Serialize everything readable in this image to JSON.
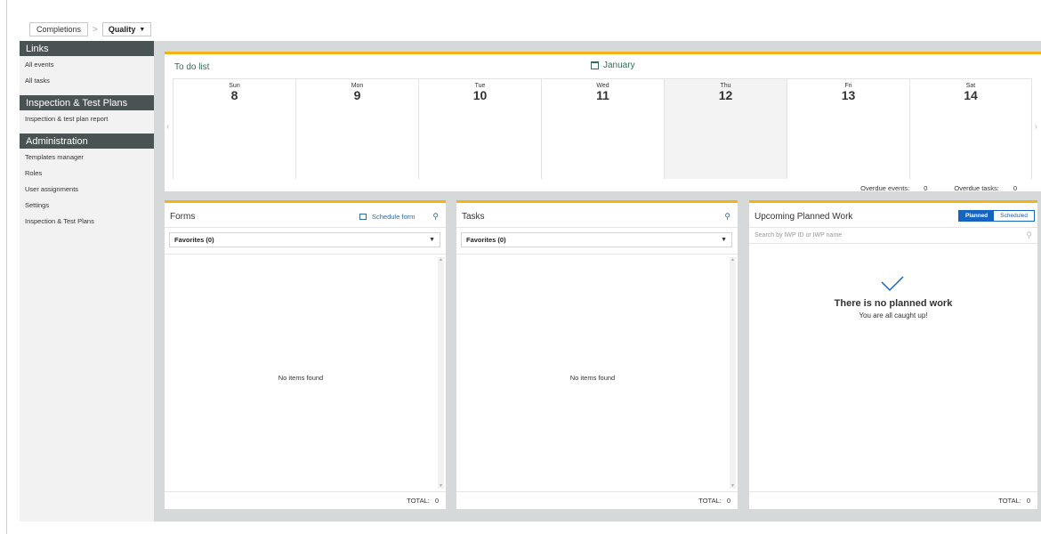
{
  "breadcrumb": {
    "root": "Completions",
    "separator": ">",
    "current": "Quality"
  },
  "sidebar": {
    "sections": [
      {
        "title": "Links",
        "items": [
          "All events",
          "All tasks"
        ]
      },
      {
        "title": "Inspection & Test Plans",
        "items": [
          "Inspection & test plan report"
        ]
      },
      {
        "title": "Administration",
        "items": [
          "Templates manager",
          "Roles",
          "User assignments",
          "Settings",
          "Inspection & Test Plans"
        ]
      }
    ]
  },
  "todo": {
    "title": "To do list",
    "month": "January",
    "days": [
      {
        "name": "Sun",
        "num": "8"
      },
      {
        "name": "Mon",
        "num": "9"
      },
      {
        "name": "Tue",
        "num": "10"
      },
      {
        "name": "Wed",
        "num": "11"
      },
      {
        "name": "Thu",
        "num": "12"
      },
      {
        "name": "Fri",
        "num": "13"
      },
      {
        "name": "Sat",
        "num": "14"
      }
    ],
    "overdue_events_label": "Overdue events:",
    "overdue_events_value": "0",
    "overdue_tasks_label": "Overdue tasks:",
    "overdue_tasks_value": "0"
  },
  "forms": {
    "title": "Forms",
    "schedule_label": "Schedule form",
    "dropdown": "Favorites (0)",
    "empty": "No items found",
    "total_label": "TOTAL:",
    "total_value": "0"
  },
  "tasks": {
    "title": "Tasks",
    "dropdown": "Favorites (0)",
    "empty": "No items found",
    "total_label": "TOTAL:",
    "total_value": "0"
  },
  "work": {
    "title": "Upcoming Planned Work",
    "toggle_planned": "Planned",
    "toggle_scheduled": "Scheduled",
    "search_placeholder": "Search by IWP ID or IWP name",
    "empty_title": "There is no planned work",
    "empty_sub": "You are all caught up!",
    "total_label": "TOTAL:",
    "total_value": "0"
  },
  "colors": {
    "accent": "#f2b315",
    "sidebar_header": "#4a5354",
    "link": "#2d6a9f",
    "toggle": "#1565c0",
    "title_green": "#2f6f56"
  }
}
